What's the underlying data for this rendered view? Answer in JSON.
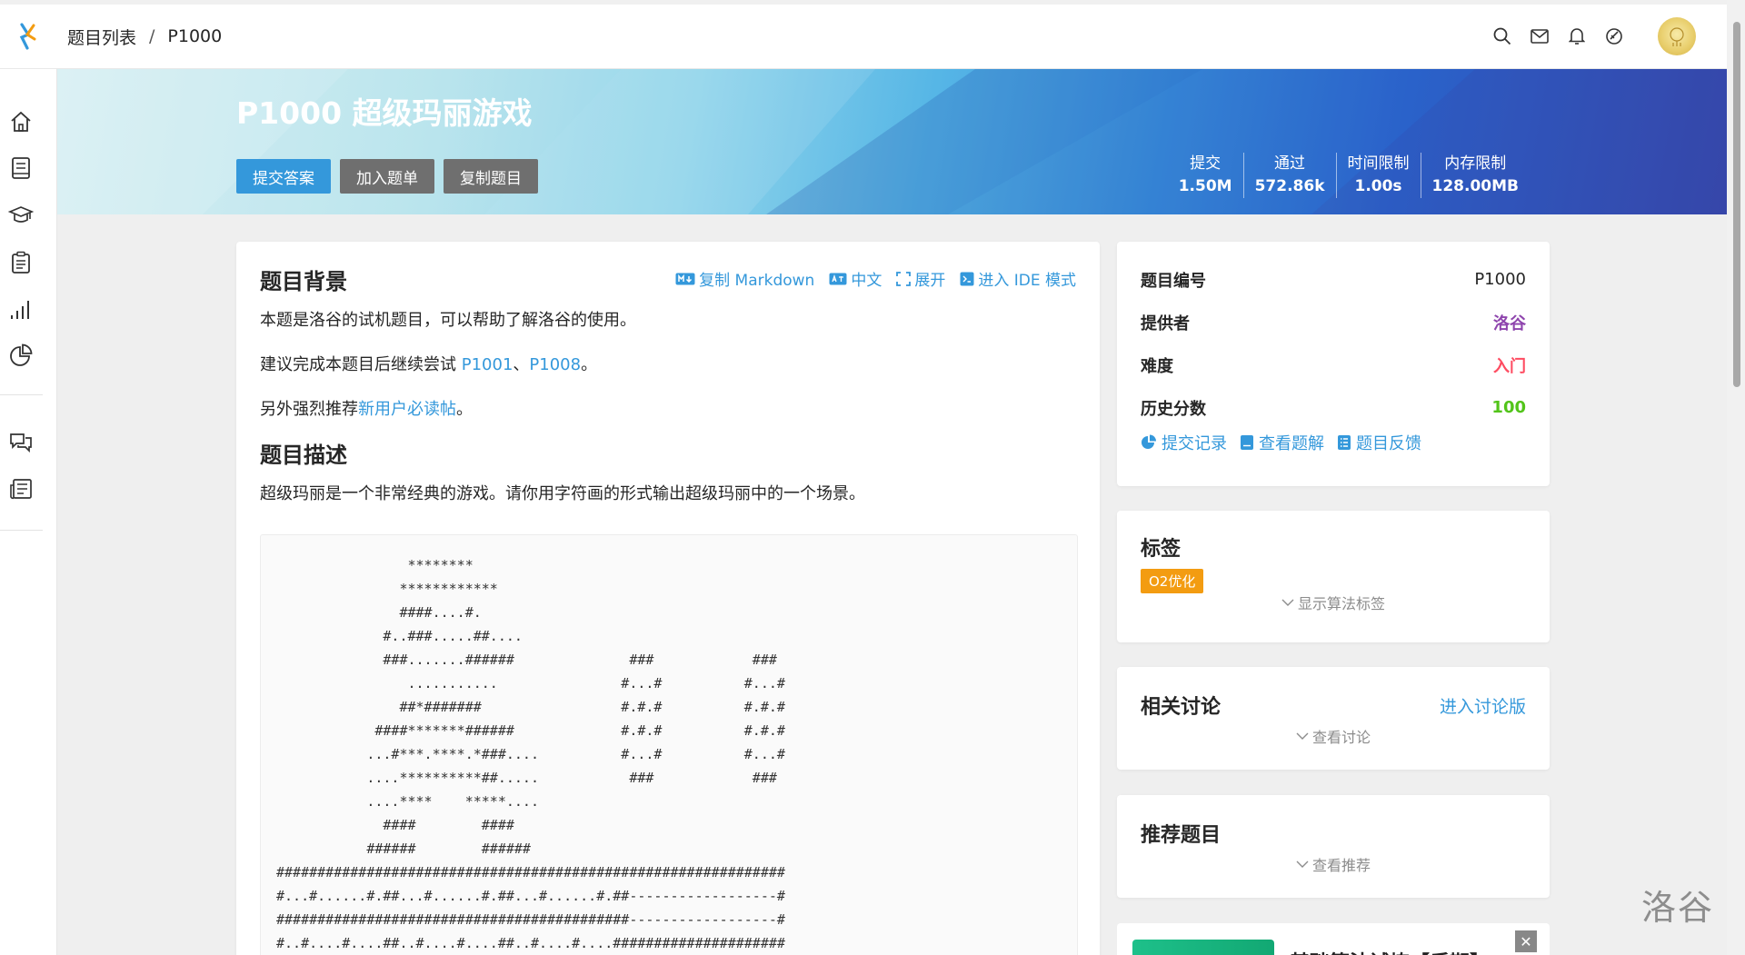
{
  "topbar": {
    "breadcrumb": [
      "题目列表",
      "/",
      "P1000"
    ]
  },
  "banner": {
    "title": "P1000 超级玛丽游戏",
    "buttons": {
      "submit": "提交答案",
      "add_list": "加入题单",
      "copy": "复制题目"
    },
    "stats": [
      {
        "label": "提交",
        "value": "1.50M"
      },
      {
        "label": "通过",
        "value": "572.86k"
      },
      {
        "label": "时间限制",
        "value": "1.00s"
      },
      {
        "label": "内存限制",
        "value": "128.00MB"
      }
    ]
  },
  "main": {
    "background_title": "题目背景",
    "ops": {
      "copy_md": "复制 Markdown",
      "lang": "中文",
      "expand": "展开",
      "ide": "进入 IDE 模式"
    },
    "bg_p1": "本题是洛谷的试机题目，可以帮助了解洛谷的使用。",
    "bg_p2_pre": "建议完成本题目后继续尝试 ",
    "bg_p2_link1": "P1001",
    "bg_p2_mid": "、",
    "bg_p2_link2": "P1008",
    "bg_p2_post": "。",
    "bg_p3_pre": "另外强烈推荐",
    "bg_p3_link": "新用户必读帖",
    "bg_p3_post": "。",
    "desc_title": "题目描述",
    "desc_p1": "超级玛丽是一个非常经典的游戏。请你用字符画的形式输出超级玛丽中的一个场景。",
    "code": "                ********\n               ************\n               ####....#.\n             #..###.....##....\n             ###.......######              ###            ###\n                ...........               #...#          #...#\n               ##*#######                 #.#.#          #.#.#\n            ####*******######             #.#.#          #.#.#\n           ...#***.****.*###....          #...#          #...#\n           ....**********##.....           ###            ###\n           ....****    *****....\n             ####        ####\n           ######        ######\n##############################################################\n#...#......#.##...#......#.##...#......#.##------------------#\n###########################################------------------#\n#..#....#....##..#....#....##..#....#....#####################"
  },
  "info": {
    "rows": [
      {
        "k": "题目编号",
        "v": "P1000",
        "color": "#262626"
      },
      {
        "k": "提供者",
        "v": "洛谷",
        "color": "#8e44ad"
      },
      {
        "k": "难度",
        "v": "入门",
        "color": "#fe4c61"
      },
      {
        "k": "历史分数",
        "v": "100",
        "color": "#52c41a"
      }
    ],
    "links": {
      "records": "提交记录",
      "solutions": "查看题解",
      "feedback": "题目反馈"
    }
  },
  "tags_card": {
    "title": "标签",
    "tag": "O2优化",
    "toggle": "显示算法标签"
  },
  "discuss_card": {
    "title": "相关讨论",
    "enter": "进入讨论版",
    "toggle": "查看讨论"
  },
  "recommend_card": {
    "title": "推荐题目",
    "toggle": "查看推荐"
  },
  "ad": {
    "text": "基础算法试炼【后期】",
    "close": "✕"
  },
  "watermark": "洛谷",
  "colors": {
    "accent": "#3498db",
    "gray_button": "#6f6f6f",
    "tag": "#f39c11"
  }
}
